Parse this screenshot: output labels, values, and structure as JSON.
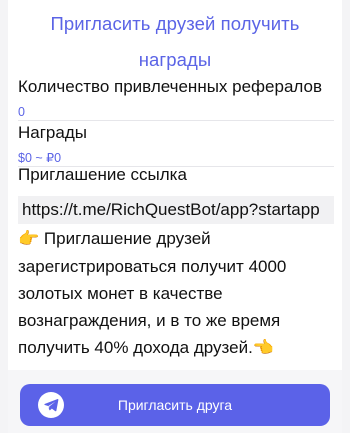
{
  "header": {
    "title_line1": "Пригласить друзей получить",
    "title_line2": "награды"
  },
  "stats": {
    "referrals_label": "Количество привлеченных рефералов",
    "referrals_value": "0",
    "rewards_label": "Награды",
    "rewards_value": "$0 ~ ₽0"
  },
  "invite_link": {
    "label": "Приглашение ссылка",
    "url": "https://t.me/RichQuestBot/app?startapp"
  },
  "description": {
    "lead_icon": "👉",
    "text": "Приглашение друзей зарегистрироваться получит 4000 золотых монет в качестве вознаграждения, и в то же время получить 40% дохода друзей.",
    "trail_icon": "👈"
  },
  "button": {
    "label": "Пригласить друга",
    "icon": "telegram-plane-icon"
  },
  "colors": {
    "accent": "#5b64e6",
    "button": "#5b62e8"
  }
}
